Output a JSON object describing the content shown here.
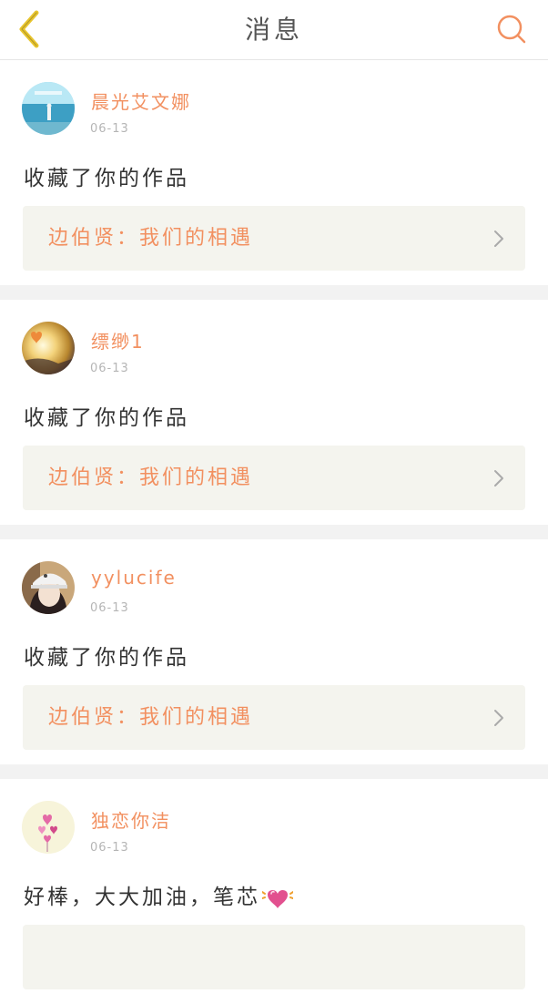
{
  "header": {
    "title": "消息",
    "back_icon": "chevron-left-icon",
    "search_icon": "search-icon"
  },
  "colors": {
    "accent": "#f29060",
    "back_icon": "#e8c52e",
    "work_bg": "#f4f4ee",
    "divider": "#f2f2f2"
  },
  "messages": [
    {
      "username": "晨光艾文娜",
      "date": "06-13",
      "action": "收藏了你的作品",
      "work_title": "边伯贤：我们的相遇",
      "avatar": "avatar-ocean"
    },
    {
      "username": "缥缈1",
      "date": "06-13",
      "action": "收藏了你的作品",
      "work_title": "边伯贤：我们的相遇",
      "avatar": "avatar-sunset"
    },
    {
      "username": "yylucife",
      "date": "06-13",
      "action": "收藏了你的作品",
      "work_title": "边伯贤：我们的相遇",
      "avatar": "avatar-portrait"
    },
    {
      "username": "独恋你洁",
      "date": "06-13",
      "action": "好棒，大大加油，笔芯",
      "work_title": "",
      "avatar": "avatar-hearts",
      "emoji": "heart-emoji-icon"
    }
  ]
}
